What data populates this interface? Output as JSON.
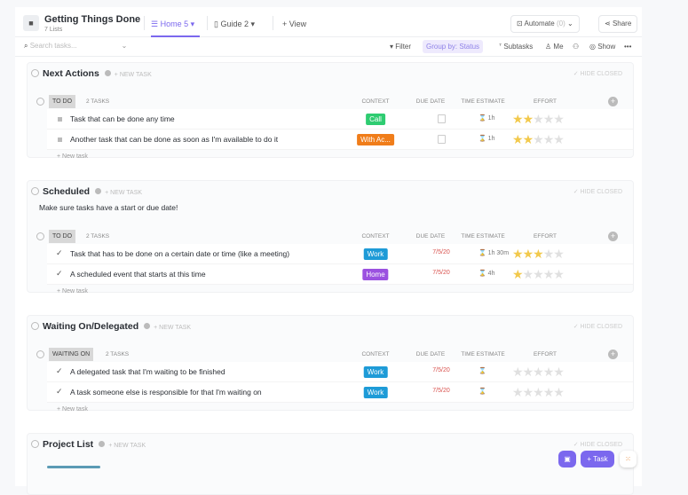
{
  "header": {
    "title": "Getting Things Done",
    "subtitle": "7 Lists",
    "tabs": [
      {
        "label": "Home",
        "count": "5 ▾"
      },
      {
        "label": "Guide",
        "count": "2 ▾"
      }
    ],
    "add_view": "+ View",
    "automate": "Automate",
    "automate_count": "(0)",
    "share": "Share"
  },
  "toolbar": {
    "search_placeholder": "Search tasks...",
    "filter": "Filter",
    "group_by": "Group by: Status",
    "subtasks": "Subtasks",
    "me": "Me",
    "show": "Show",
    "more": "•••"
  },
  "columns": {
    "context": "CONTEXT",
    "due": "DUE DATE",
    "estimate": "TIME ESTIMATE",
    "effort": "EFFORT"
  },
  "new_task_header": "+ NEW TASK",
  "hide_closed": "✓ HIDE CLOSED",
  "new_task_row": "+ New task",
  "sections": [
    {
      "title": "Next Actions",
      "status": "TO DO",
      "count": "2 TASKS",
      "tasks": [
        {
          "name": "Task that can be done any time",
          "context": "Call",
          "color": "#2ecc71",
          "due": "",
          "estimate": "1h",
          "effort": 2,
          "done": false
        },
        {
          "name": "Another task that can be done as soon as I'm available to do it",
          "context": "With Ac...",
          "color": "#f07d1a",
          "due": "",
          "estimate": "1h",
          "effort": 2,
          "done": false
        }
      ]
    },
    {
      "title": "Scheduled",
      "description": "Make sure tasks have a start or due date!",
      "status": "TO DO",
      "count": "2 TASKS",
      "tasks": [
        {
          "name": "Task that has to be done on a certain date or time (like a meeting)",
          "context": "Work",
          "color": "#1e9bd7",
          "due": "7/5/20",
          "estimate": "1h 30m",
          "effort": 3,
          "done": true
        },
        {
          "name": "A scheduled event that starts at this time",
          "context": "Home",
          "color": "#9b51e0",
          "due": "7/5/20",
          "estimate": "4h",
          "effort": 1,
          "done": true
        }
      ]
    },
    {
      "title": "Waiting On/Delegated",
      "status": "WAITING ON",
      "count": "2 TASKS",
      "tasks": [
        {
          "name": "A delegated task that I'm waiting to be finished",
          "context": "Work",
          "color": "#1e9bd7",
          "due": "7/5/20",
          "estimate": "",
          "effort": 0,
          "done": true
        },
        {
          "name": "A task someone else is responsible for that I'm waiting on",
          "context": "Work",
          "color": "#1e9bd7",
          "due": "7/5/20",
          "estimate": "",
          "effort": 0,
          "done": true
        }
      ]
    },
    {
      "title": "Project List",
      "tasks": []
    }
  ],
  "fab": {
    "task": "+ Task"
  }
}
